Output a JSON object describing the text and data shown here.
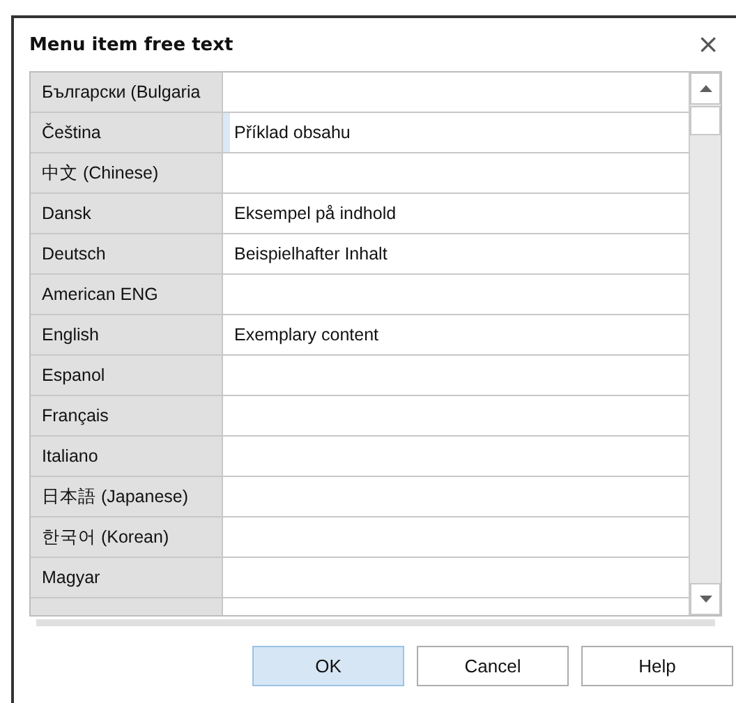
{
  "window": {
    "title": "Menu item free text",
    "close": "×"
  },
  "rows": [
    {
      "language": "Български (Bulgaria",
      "selected": false
    },
    {
      "language": "Čeština",
      "value": "Příklad obsahu",
      "selected": true
    },
    {
      "language": "中文 (Chinese)",
      "selected": false
    },
    {
      "language": "Dansk",
      "value": "Eksempel på indhold",
      "selected": false
    },
    {
      "language": "Deutsch",
      "value": "Beispielhafter Inhalt",
      "selected": false
    },
    {
      "language": "American ENG",
      "selected": false
    },
    {
      "language": "English",
      "value": "Exemplary content",
      "selected": false
    },
    {
      "language": "Espanol",
      "selected": false
    },
    {
      "language": "Français",
      "selected": false
    },
    {
      "language": "Italiano",
      "selected": false
    },
    {
      "language": "日本語 (Japanese)",
      "selected": false
    },
    {
      "language": "한국어 (Korean)",
      "selected": false
    },
    {
      "language": "Magyar",
      "selected": false
    }
  ],
  "buttons": [
    {
      "label": "OK",
      "default": true
    },
    {
      "label": "Cancel",
      "default": false
    },
    {
      "label": "Help",
      "default": false
    }
  ]
}
